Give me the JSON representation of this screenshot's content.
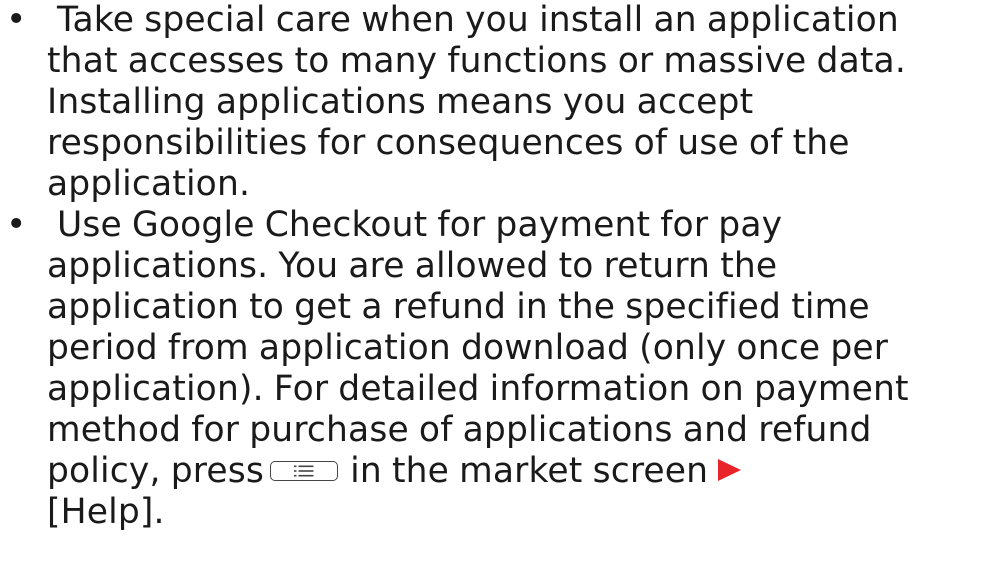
{
  "bullets": [
    {
      "marker": "•",
      "lines": [
        "Take special care when you install an application",
        "that accesses to many functions or massive data.",
        "Installing applications means you accept",
        "responsibilities for consequences of use of the",
        "application."
      ]
    },
    {
      "marker": "•",
      "lines": [
        "Use Google Checkout for payment for pay",
        "applications. You are allowed to return the",
        "application to get a refund in the specified time",
        "period from application download (only once per",
        "application). For detailed information on payment",
        "method for purchase of applications and refund"
      ],
      "policy_prefix": "policy, press",
      "policy_suffix": "in the market screen",
      "last_line": "[Help]."
    }
  ],
  "icons": {
    "menu_key": "menu-key-icon",
    "arrow": "red-right-triangle-icon"
  },
  "colors": {
    "text": "#1a1a1a",
    "arrow": "#e8232a"
  }
}
